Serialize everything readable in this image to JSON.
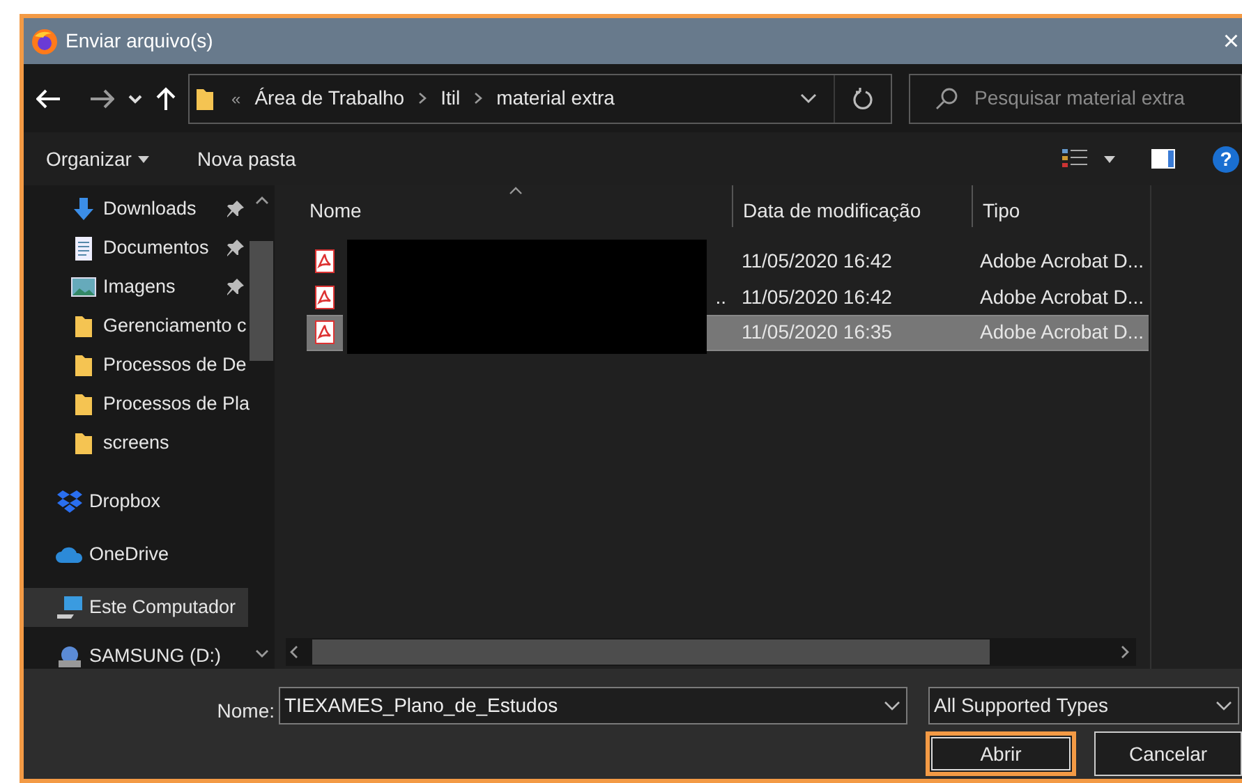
{
  "window": {
    "title": "Enviar arquivo(s)",
    "close": "×"
  },
  "address_bar": {
    "overflow": "«",
    "path": [
      "Área de Trabalho",
      "Itil",
      "material extra"
    ]
  },
  "search": {
    "placeholder": "Pesquisar material extra"
  },
  "toolbar": {
    "organize": "Organizar",
    "new_folder": "Nova pasta",
    "help": "?"
  },
  "sidebar": {
    "items": [
      {
        "label": "Downloads",
        "kind": "download",
        "pinned": true,
        "selected": false
      },
      {
        "label": "Documentos",
        "kind": "document",
        "pinned": true,
        "selected": false
      },
      {
        "label": "Imagens",
        "kind": "images",
        "pinned": true,
        "selected": false
      },
      {
        "label": "Gerenciamento c",
        "kind": "folder",
        "pinned": false,
        "selected": false
      },
      {
        "label": "Processos de De",
        "kind": "folder",
        "pinned": false,
        "selected": false
      },
      {
        "label": "Processos de Pla",
        "kind": "folder",
        "pinned": false,
        "selected": false
      },
      {
        "label": "screens",
        "kind": "folder",
        "pinned": false,
        "selected": false
      },
      {
        "label": "Dropbox",
        "kind": "dropbox",
        "pinned": false,
        "selected": false
      },
      {
        "label": "OneDrive",
        "kind": "cloud",
        "pinned": false,
        "selected": false
      },
      {
        "label": "Este Computador",
        "kind": "computer",
        "pinned": false,
        "selected": true
      },
      {
        "label": "SAMSUNG (D:)",
        "kind": "drive",
        "pinned": false,
        "selected": false
      }
    ]
  },
  "file_list": {
    "columns": [
      "Nome",
      "Data de modificação",
      "Tipo"
    ],
    "rows": [
      {
        "date": "11/05/2020 16:42",
        "type": "Adobe Acrobat D...",
        "selected": false
      },
      {
        "name": "..",
        "date": "11/05/2020 16:42",
        "type": "Adobe Acrobat D...",
        "selected": false
      },
      {
        "date": "11/05/2020 16:35",
        "type": "Adobe Acrobat D...",
        "selected": true
      }
    ]
  },
  "footer": {
    "name_label": "Nome:",
    "file_name": "TIEXAMES_Plano_de_Estudos",
    "file_type": "All Supported Types",
    "buttons": [
      {
        "label": "Abrir",
        "focused": true
      },
      {
        "label": "Cancelar",
        "focused": false
      }
    ]
  }
}
